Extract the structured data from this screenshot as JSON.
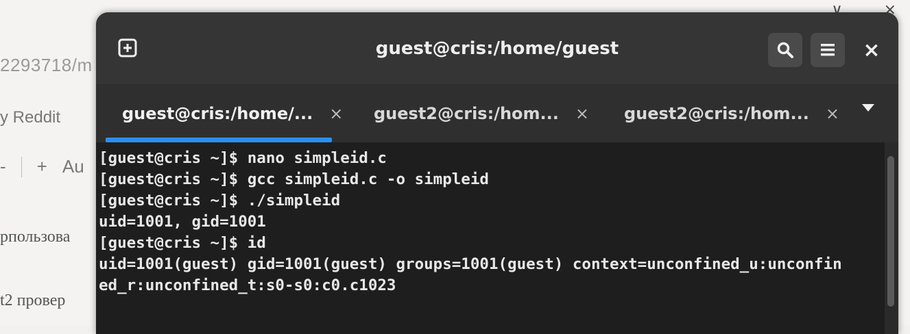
{
  "background_window": {
    "url_fragment": "2293718/m",
    "bookmark": "y Reddit",
    "toolbar": {
      "minus": "-",
      "plus": "+",
      "text": "Au"
    },
    "doc_lines": [
      "рпользова",
      "t2 провер"
    ],
    "controls": {
      "chevron": "∨",
      "close": "×"
    }
  },
  "terminal": {
    "title": "guest@cris:/home/guest",
    "tabs": [
      {
        "label": "guest@cris:/home/...",
        "active": true
      },
      {
        "label": "guest2@cris:/hom...",
        "active": false
      },
      {
        "label": "guest2@cris:/hom...",
        "active": false
      }
    ],
    "tab_close_glyph": "×",
    "close_glyph": "×",
    "lines": [
      "[guest@cris ~]$ nano simpleid.c",
      "[guest@cris ~]$ gcc simpleid.c -o simpleid",
      "[guest@cris ~]$ ./simpleid",
      "uid=1001, gid=1001",
      "[guest@cris ~]$ id",
      "uid=1001(guest) gid=1001(guest) groups=1001(guest) context=unconfined_u:unconfin",
      "ed_r:unconfined_t:s0-s0:c0.c1023"
    ]
  },
  "colors": {
    "accent": "#2a8ff0",
    "terminal_bg": "#1e1e1e",
    "header_bg": "#353535"
  },
  "icons": [
    "new-tab-icon",
    "search-icon",
    "hamburger-menu-icon",
    "close-icon",
    "chevron-down-icon"
  ]
}
